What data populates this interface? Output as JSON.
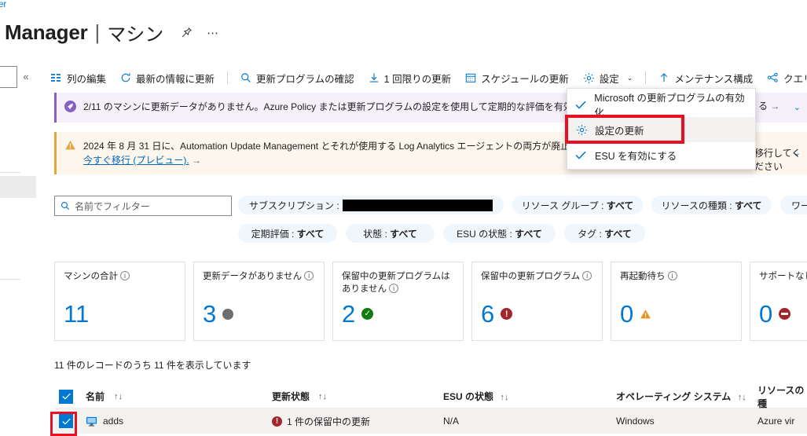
{
  "breadcrumb": "er",
  "header": {
    "title": "Manager",
    "separator": "|",
    "subtitle": "マシン",
    "pin_icon": "pin-icon",
    "more_icon": "more-ellipsis-icon"
  },
  "rail": {
    "collapse_label": "«"
  },
  "toolbar": {
    "items": [
      {
        "icon": "columns-icon",
        "label": "列の編集"
      },
      {
        "icon": "refresh-icon",
        "label": "最新の情報に更新"
      },
      {
        "icon": "search-icon",
        "label": "更新プログラムの確認"
      },
      {
        "icon": "download-icon",
        "label": "1 回限りの更新"
      },
      {
        "icon": "calendar-icon",
        "label": "スケジュールの更新"
      },
      {
        "icon": "gear-icon",
        "label": "設定",
        "chevron": "⌄"
      },
      {
        "icon": "arrow-up-icon",
        "label": "メンテナンス構成"
      },
      {
        "icon": "query-icon",
        "label": "クエリを開"
      }
    ]
  },
  "settings_menu": {
    "items": [
      {
        "icon": "check-icon",
        "label": "Microsoft の更新プログラムの有効化",
        "highlighted": false
      },
      {
        "icon": "gear-icon",
        "label": "設定の更新",
        "highlighted": true
      },
      {
        "icon": "check-icon",
        "label": "ESU を有効にする",
        "highlighted": false
      }
    ],
    "highlight_color": "#e81123"
  },
  "banners": [
    {
      "icon": "rocket-icon",
      "text": "2/11 のマシンに更新データがありません。Azure Policy または更新プログラムの設定を使用して定期的な評価を有効にして、定期",
      "tail": "る",
      "arrow": "→",
      "chevron": "⌄",
      "bg": "#f6f0fa",
      "accent": "#8661c5"
    },
    {
      "icon": "warning-icon",
      "text": "2024 年 8 月 31 日に、Automation Update Management とそれが使用する Log Analytics エージェントの両方が廃止さ",
      "tail": "移行してください",
      "link": "今すぐ移行 (プレビュー).",
      "arrow": "→",
      "chevron": "⌄",
      "bg": "#fdf6ec",
      "accent": "#e8a33d"
    }
  ],
  "filters": {
    "search_placeholder": "名前でフィルター",
    "search_value": "",
    "search_icon": "search-icon",
    "pills_row1": [
      {
        "label": "サブスクリプション :",
        "value": "",
        "redacted": true
      },
      {
        "label": "リソース グループ :",
        "value": "すべて"
      },
      {
        "label": "リソースの種類 :",
        "value": "すべて"
      },
      {
        "label": "ワー",
        "value": "",
        "truncated": true
      }
    ],
    "pills_row2": [
      {
        "label": "定期評価 :",
        "value": "すべて"
      },
      {
        "label": "状態 :",
        "value": "すべて"
      },
      {
        "label": "ESU の状態 :",
        "value": "すべて"
      },
      {
        "label": "タグ :",
        "value": "すべて"
      }
    ]
  },
  "cards": [
    {
      "title": "マシンの合計",
      "info": true,
      "value": "11",
      "badge": "none"
    },
    {
      "title": "更新データがありません",
      "info": true,
      "value": "3",
      "badge": "grey-dot"
    },
    {
      "title": "保留中の更新プログラムは ありません",
      "info": true,
      "value": "2",
      "badge": "green-check"
    },
    {
      "title": "保留中の更新プログラム",
      "info": true,
      "value": "6",
      "badge": "red-error"
    },
    {
      "title": "再起動待ち",
      "info": true,
      "value": "0",
      "badge": "orange-warning"
    },
    {
      "title": "サポートなし",
      "info": true,
      "value": "0",
      "badge": "red-block"
    }
  ],
  "table": {
    "record_count": "11 件のレコードのうち 11 件を表示しています",
    "sort_glyph": "↑↓",
    "columns": [
      {
        "key": "name",
        "label": "名前",
        "sortable": true
      },
      {
        "key": "update_status",
        "label": "更新状態",
        "sortable": true
      },
      {
        "key": "esu_status",
        "label": "ESU の状態",
        "sortable": true
      },
      {
        "key": "os",
        "label": "オペレーティング システム",
        "sortable": true
      },
      {
        "key": "resource_type",
        "label": "リソースの種",
        "sortable": false
      }
    ],
    "rows": [
      {
        "selected": true,
        "icon": "virtual-machine-icon",
        "name": "adds",
        "update_status": "1 件の保留中の更新",
        "update_status_badge": "error",
        "esu_status": "N/A",
        "os": "Windows",
        "resource_type": "Azure vir"
      }
    ],
    "row_highlight_color": "#e81123"
  }
}
